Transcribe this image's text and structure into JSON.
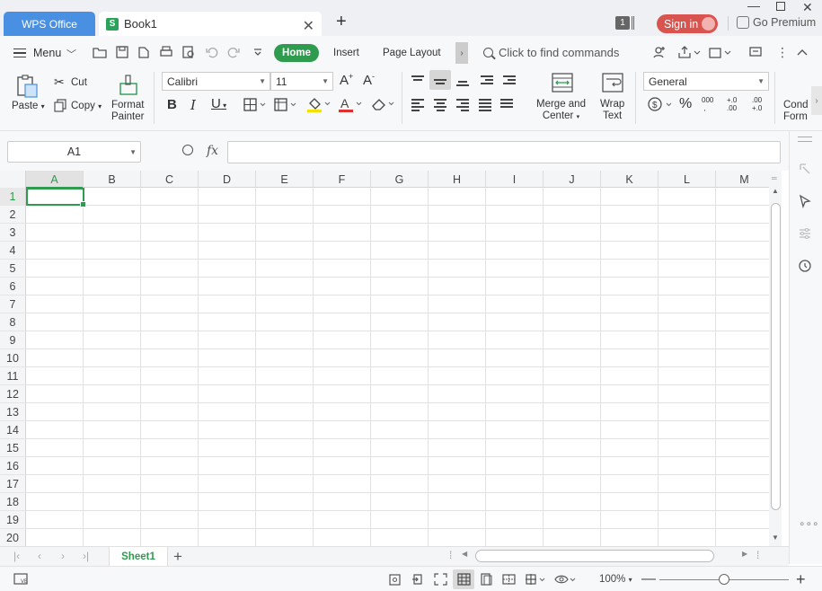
{
  "titlebar": {
    "app_tab": "WPS Office",
    "doc_tab": "Book1",
    "doc_icon": "S",
    "window_count": "1",
    "sign_in": "Sign in",
    "premium": "Go Premium"
  },
  "menubar": {
    "menu_label": "Menu",
    "tabs": [
      "Home",
      "Insert",
      "Page Layout"
    ],
    "find_commands": "Click to find commands"
  },
  "ribbon": {
    "paste": "Paste",
    "cut": "Cut",
    "copy": "Copy",
    "format_painter_1": "Format",
    "format_painter_2": "Painter",
    "font_name": "Calibri",
    "font_size": "11",
    "merge_center_1": "Merge and",
    "merge_center_2": "Center",
    "wrap_text_1": "Wrap",
    "wrap_text_2": "Text",
    "number_format": "General",
    "cond_format_1": "Cond",
    "cond_format_2": "Form"
  },
  "formula_bar": {
    "name_box": "A1",
    "fx": "fx",
    "formula": ""
  },
  "grid": {
    "columns": [
      "A",
      "B",
      "C",
      "D",
      "E",
      "F",
      "G",
      "H",
      "I",
      "J",
      "K",
      "L",
      "M"
    ],
    "rows": [
      "1",
      "2",
      "3",
      "4",
      "5",
      "6",
      "7",
      "8",
      "9",
      "10",
      "11",
      "12",
      "13",
      "14",
      "15",
      "16",
      "17",
      "18",
      "19",
      "20"
    ],
    "active_cell": "A1"
  },
  "sheets": {
    "tabs": [
      "Sheet1"
    ]
  },
  "status": {
    "zoom": "100%"
  },
  "colors": {
    "accent_green": "#2e9b4f",
    "wps_tab_blue": "#4a90e2",
    "sign_in_red": "#d9534f"
  }
}
